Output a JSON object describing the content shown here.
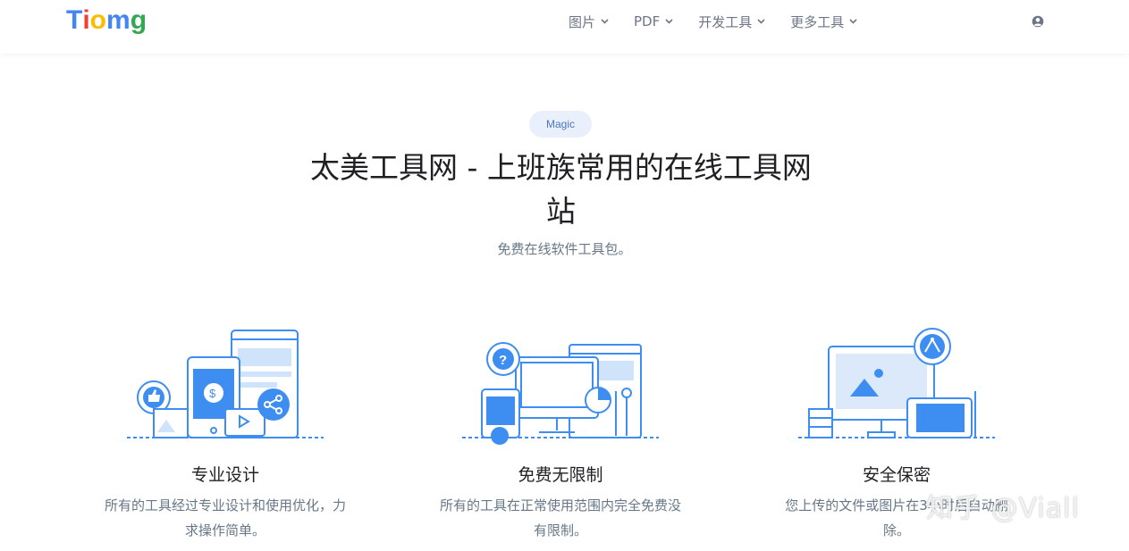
{
  "logo": {
    "letters": [
      "T",
      "i",
      "o",
      "m",
      "g"
    ],
    "colors": [
      "#4285f4",
      "#ea4335",
      "#fbbc05",
      "#4285f4",
      "#34a853"
    ]
  },
  "nav": {
    "items": [
      {
        "label": "图片",
        "icon": "chevron-down-icon"
      },
      {
        "label": "PDF",
        "icon": "chevron-down-icon"
      },
      {
        "label": "开发工具",
        "icon": "chevron-down-icon"
      },
      {
        "label": "更多工具",
        "icon": "chevron-down-icon"
      }
    ],
    "user_icon": "user-circle-icon"
  },
  "hero": {
    "badge": "Magic",
    "title_line1": "太美工具网 - 上班族常用的在线工具网",
    "title_line2": "站",
    "subtitle": "免费在线软件工具包。"
  },
  "features": [
    {
      "title": "专业设计",
      "desc_line1": "所有的工具经过专业设计和使用优化，力",
      "desc_line2": "求操作简单。",
      "illustration": "devices-share-illustration"
    },
    {
      "title": "免费无限制",
      "desc_line1": "所有的工具在正常使用范围内完全免费没",
      "desc_line2": "有限制。",
      "illustration": "desktop-tools-illustration"
    },
    {
      "title": "安全保密",
      "desc_line1": "您上传的文件或图片在3小时后自动删",
      "desc_line2": "除。",
      "illustration": "design-workstation-illustration"
    }
  ],
  "watermark": "知乎 @Viall",
  "colors": {
    "accent": "#377dff",
    "illustration_blue": "#3d8ef0",
    "badge_bg": "#e9f0fb",
    "text_muted": "#677788"
  }
}
